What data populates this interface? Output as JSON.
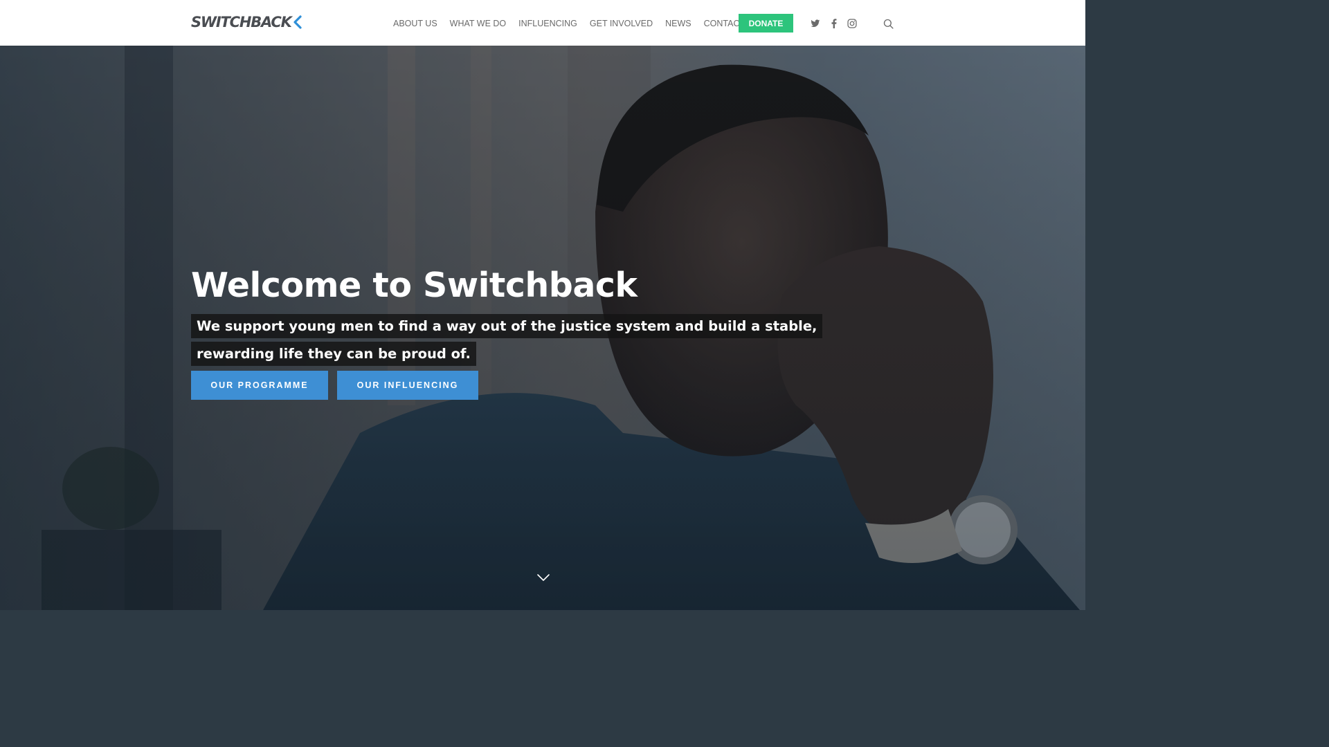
{
  "header": {
    "logo_text": "SWITCHBACK",
    "nav": [
      {
        "label": "ABOUT US"
      },
      {
        "label": "WHAT WE DO"
      },
      {
        "label": "INFLUENCING"
      },
      {
        "label": "GET INVOLVED"
      },
      {
        "label": "NEWS"
      },
      {
        "label": "CONTACT US"
      }
    ],
    "donate_label": "DONATE",
    "social_icons": [
      "twitter-icon",
      "facebook-icon",
      "instagram-icon"
    ],
    "search_icon": "search-icon"
  },
  "hero": {
    "title": "Welcome to Switchback",
    "subtitle": "We support young men to find a way out of the justice system and build a stable, rewarding life they can be proud of.",
    "buttons": [
      {
        "label": "OUR PROGRAMME"
      },
      {
        "label": "OUR INFLUENCING"
      }
    ],
    "scroll_icon": "chevron-down-icon"
  },
  "colors": {
    "donate": "#2dc47c",
    "cta": "#3e8fd4",
    "nav_text": "#6a6a6a",
    "logo_accent": "#2e8fd8"
  }
}
